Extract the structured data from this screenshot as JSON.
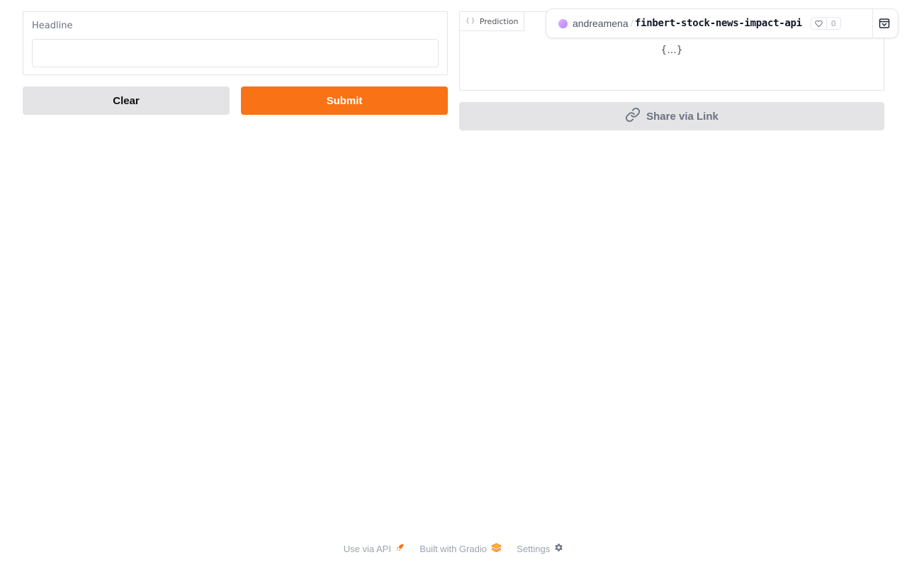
{
  "input": {
    "label": "Headline",
    "value": "",
    "placeholder": ""
  },
  "buttons": {
    "clear": "Clear",
    "submit": "Submit",
    "share": "Share via Link"
  },
  "output": {
    "label": "Prediction",
    "icon_text": "{ }",
    "placeholder": "{...}"
  },
  "space": {
    "owner": "andreamena",
    "separator": "/",
    "name": "finbert-stock-news-impact-api",
    "likes": "0"
  },
  "footer": {
    "api": "Use via API",
    "built": "Built with Gradio",
    "settings": "Settings",
    "separator": "·"
  },
  "colors": {
    "accent": "#f97316",
    "button_secondary": "#e4e4e7",
    "border": "#e4e4e7"
  },
  "icons": {
    "share": "link-icon",
    "like": "heart-icon",
    "collapse": "collapse-icon",
    "api": "rocket-icon",
    "gradio": "gradio-logo-icon",
    "settings": "gear-icon"
  }
}
